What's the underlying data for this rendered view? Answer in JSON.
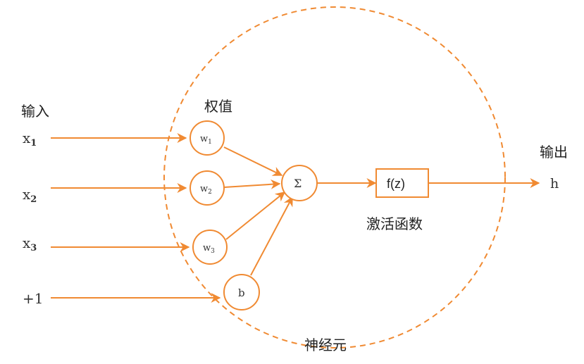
{
  "labels": {
    "input": "输入",
    "weights": "权值",
    "output": "输出",
    "activation": "激活函数",
    "neuron": "神经元"
  },
  "inputs": [
    {
      "base": "x",
      "sub": "1"
    },
    {
      "base": "x",
      "sub": "2"
    },
    {
      "base": "x",
      "sub": "3"
    },
    {
      "base": "+1",
      "sub": ""
    }
  ],
  "weights": [
    {
      "base": "w",
      "sub": "1"
    },
    {
      "base": "w",
      "sub": "2"
    },
    {
      "base": "w",
      "sub": "3"
    },
    {
      "base": "b",
      "sub": ""
    }
  ],
  "sum_symbol": "Σ",
  "function_label": "f(z)",
  "output_symbol": "h",
  "colors": {
    "accent": "#F08A32",
    "text": "#222222"
  }
}
